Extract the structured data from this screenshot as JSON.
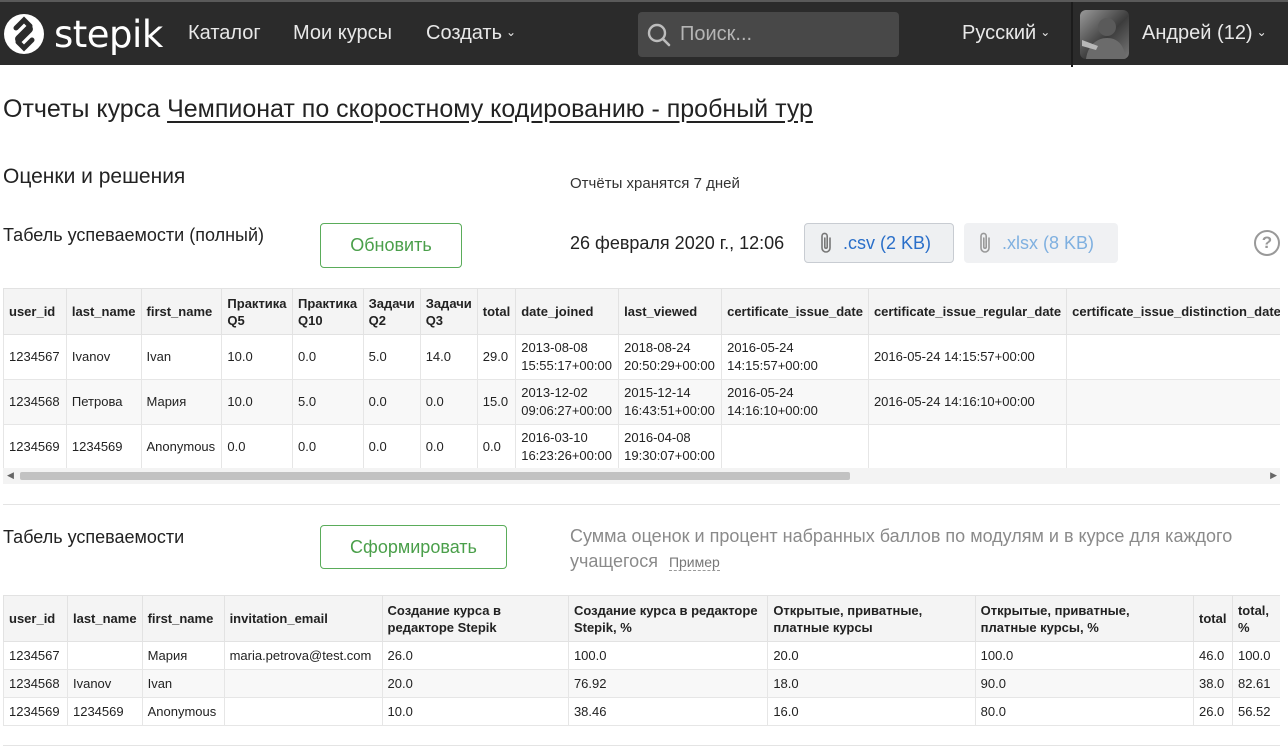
{
  "header": {
    "logo_text": "stepik",
    "nav": [
      "Каталог",
      "Мои курсы",
      "Создать"
    ],
    "search_placeholder": "Поиск...",
    "language": "Русский",
    "user": "Андрей (12)"
  },
  "page": {
    "title_prefix": "Отчеты курса",
    "course_link": "Чемпионат по скоростному кодированию - пробный тур"
  },
  "section": {
    "heading": "Оценки и решения",
    "retention_note": "Отчёты хранятся 7 дней"
  },
  "report_full": {
    "label": "Табель успеваемости (полный)",
    "button": "Обновить",
    "date": "26 февраля 2020 г., 12:06",
    "csv": ".csv (2 KB)",
    "xlsx": ".xlsx (8 KB)",
    "help": "?",
    "headers": [
      "user_id",
      "last_name",
      "first_name",
      "Практика Q5",
      "Практика Q10",
      "Задачи Q2",
      "Задачи Q3",
      "total",
      "date_joined",
      "last_viewed",
      "certificate_issue_date",
      "certificate_issue_regular_date",
      "certificate_issue_distinction_date"
    ],
    "rows": [
      [
        "1234567",
        "Ivanov",
        "Ivan",
        "10.0",
        "0.0",
        "5.0",
        "14.0",
        "29.0",
        "2013-08-08 15:55:17+00:00",
        "2018-08-24 20:50:29+00:00",
        "2016-05-24 14:15:57+00:00",
        "2016-05-24 14:15:57+00:00",
        ""
      ],
      [
        "1234568",
        "Петрова",
        "Мария",
        "10.0",
        "5.0",
        "0.0",
        "0.0",
        "15.0",
        "2013-12-02 09:06:27+00:00",
        "2015-12-14 16:43:51+00:00",
        "2016-05-24 14:16:10+00:00",
        "2016-05-24 14:16:10+00:00",
        ""
      ],
      [
        "1234569",
        "1234569",
        "Anonymous",
        "0.0",
        "0.0",
        "0.0",
        "0.0",
        "0.0",
        "2016-03-10 16:23:26+00:00",
        "2016-04-08 19:30:07+00:00",
        "",
        "",
        ""
      ]
    ]
  },
  "report_short": {
    "label": "Табель успеваемости",
    "button": "Сформировать",
    "description": "Сумма оценок и процент набранных баллов по модулям и в курсе для каждого учащегося",
    "example": "Пример",
    "headers": [
      "user_id",
      "last_name",
      "first_name",
      "invitation_email",
      "Создание курса в редакторе Stepik",
      "Создание курса в редакторе Stepik, %",
      "Открытые, приватные, платные курсы",
      "Открытые, приватные, платные курсы, %",
      "total",
      "total, %"
    ],
    "rows": [
      [
        "1234567",
        "",
        "Мария",
        "maria.petrova@test.com",
        "26.0",
        "100.0",
        "20.0",
        "100.0",
        "46.0",
        "100.0"
      ],
      [
        "1234568",
        "Ivanov",
        "Ivan",
        "",
        "20.0",
        "76.92",
        "18.0",
        "90.0",
        "38.0",
        "82.61"
      ],
      [
        "1234569",
        "1234569",
        "Anonymous",
        "",
        "10.0",
        "38.46",
        "16.0",
        "80.0",
        "26.0",
        "56.52"
      ]
    ]
  },
  "colors": {
    "topbar": "#2b2b2b",
    "accent_green": "#4a9f4a",
    "link_blue": "#2a6fc9"
  }
}
